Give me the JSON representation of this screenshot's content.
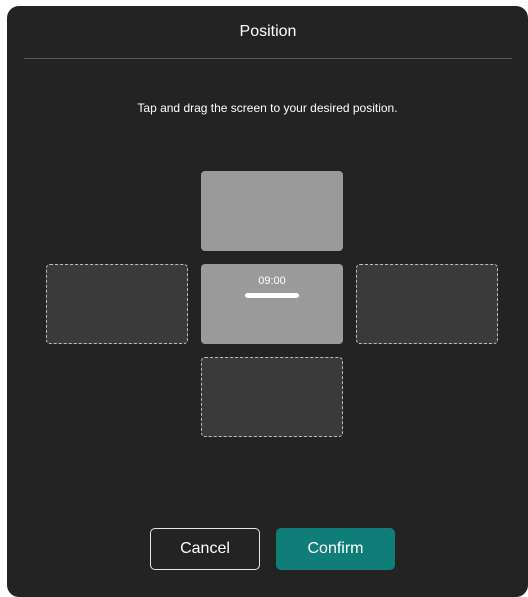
{
  "dialog": {
    "title": "Position",
    "instruction": "Tap and drag the screen to your desired position."
  },
  "positions": {
    "top": {
      "state": "filled"
    },
    "left": {
      "state": "empty"
    },
    "center": {
      "state": "selected",
      "time": "09:00"
    },
    "right": {
      "state": "empty"
    },
    "bottom": {
      "state": "empty"
    }
  },
  "buttons": {
    "cancel_label": "Cancel",
    "confirm_label": "Confirm"
  },
  "colors": {
    "background": "#232323",
    "confirm_accent": "#0f7e78",
    "slot_filled": "#9a9a9a",
    "slot_empty": "#3a3a3a"
  }
}
